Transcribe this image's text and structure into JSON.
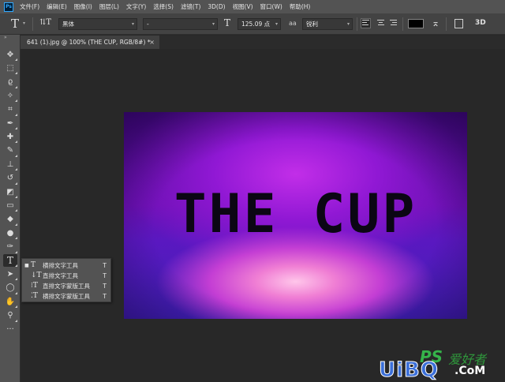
{
  "app": {
    "logo_text": "Ps"
  },
  "menu": [
    "文件(F)",
    "编辑(E)",
    "图像(I)",
    "图层(L)",
    "文字(Y)",
    "选择(S)",
    "滤镜(T)",
    "3D(D)",
    "视图(V)",
    "窗口(W)",
    "帮助(H)"
  ],
  "options_bar": {
    "tool_glyph": "T",
    "orientation_glyph": "⇅T",
    "font_family": "黑体",
    "font_style": "-",
    "size_glyph": "T",
    "font_size": "125.09 点",
    "aa_label": "aa",
    "antialias": "锐利",
    "text_color": "#000000",
    "warp_glyph": "⌅",
    "three_d_label": "3D"
  },
  "document_tab": {
    "title": "641 (1).jpg @ 100% (THE CUP, RGB/8#) *",
    "close": "×"
  },
  "toolbar": {
    "collapse": "»",
    "tools": [
      {
        "name": "move-tool-icon",
        "glyph": "✥"
      },
      {
        "name": "marquee-tool-icon",
        "glyph": "⬚"
      },
      {
        "name": "lasso-tool-icon",
        "glyph": "ϱ"
      },
      {
        "name": "magic-wand-tool-icon",
        "glyph": "✧"
      },
      {
        "name": "crop-tool-icon",
        "glyph": "⌗"
      },
      {
        "name": "eyedropper-tool-icon",
        "glyph": "✒"
      },
      {
        "name": "healing-brush-tool-icon",
        "glyph": "✚"
      },
      {
        "name": "brush-tool-icon",
        "glyph": "✎"
      },
      {
        "name": "clone-stamp-tool-icon",
        "glyph": "⊥"
      },
      {
        "name": "history-brush-tool-icon",
        "glyph": "↺"
      },
      {
        "name": "eraser-tool-icon",
        "glyph": "◩"
      },
      {
        "name": "gradient-tool-icon",
        "glyph": "▭"
      },
      {
        "name": "blur-tool-icon",
        "glyph": "◆"
      },
      {
        "name": "dodge-tool-icon",
        "glyph": "●"
      },
      {
        "name": "pen-tool-icon",
        "glyph": "✑"
      },
      {
        "name": "type-tool-icon",
        "glyph": "T"
      },
      {
        "name": "path-selection-tool-icon",
        "glyph": "➤"
      },
      {
        "name": "ellipse-tool-icon",
        "glyph": "◯"
      },
      {
        "name": "hand-tool-icon",
        "glyph": "✋"
      },
      {
        "name": "zoom-tool-icon",
        "glyph": "⚲"
      },
      {
        "name": "more-tools-icon",
        "glyph": "···"
      }
    ],
    "foreground_color": "#ffffff",
    "background_color": "#000000"
  },
  "canvas": {
    "text": "THE CUP"
  },
  "type_flyout": [
    {
      "icon": "T",
      "label": "横排文字工具",
      "key": "T",
      "selected": true
    },
    {
      "icon": "↓T",
      "label": "直排文字工具",
      "key": "T",
      "selected": false
    },
    {
      "icon": "⁝T",
      "label": "直排文字蒙版工具",
      "key": "T",
      "selected": false
    },
    {
      "icon": "⁚T",
      "label": "横排文字蒙版工具",
      "key": "T",
      "selected": false
    }
  ],
  "watermark": {
    "ps": "PS",
    "cn": "爱好者",
    "site": "UiBQ",
    "tld": ".CoM"
  }
}
